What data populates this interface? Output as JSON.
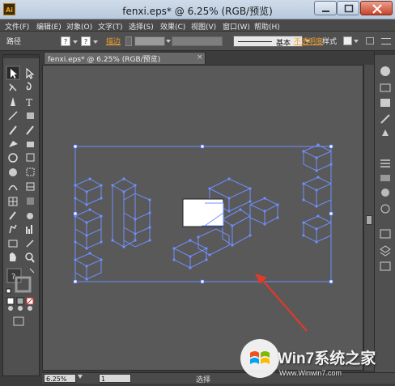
{
  "window": {
    "title": "fenxi.eps* @ 6.25% (RGB/预览)",
    "app_icon": "Ai"
  },
  "menu": [
    "文件(F)",
    "编辑(E)",
    "对象(O)",
    "文字(T)",
    "选择(S)",
    "效果(C)",
    "视图(V)",
    "窗口(W)",
    "帮助(H)"
  ],
  "control": {
    "path_label": "路径",
    "stroke_label": "描边",
    "stroke_width_label": "基本",
    "opacity_label": "不透明度",
    "style_label": "样式"
  },
  "tab": {
    "label": "fenxi.eps* @ 6.25% (RGB/预览)",
    "close": "×"
  },
  "status": {
    "zoom": "6.25%",
    "page": "1",
    "tool_label": "选择"
  },
  "watermark": {
    "text": "Win7系统之家",
    "url": "Www.Winwin7.com"
  },
  "colors": {
    "selection": "#6e8fff",
    "annotation_arrow": "#e03a2a",
    "canvas_bg": "#595959",
    "ui_bg": "#505050"
  }
}
